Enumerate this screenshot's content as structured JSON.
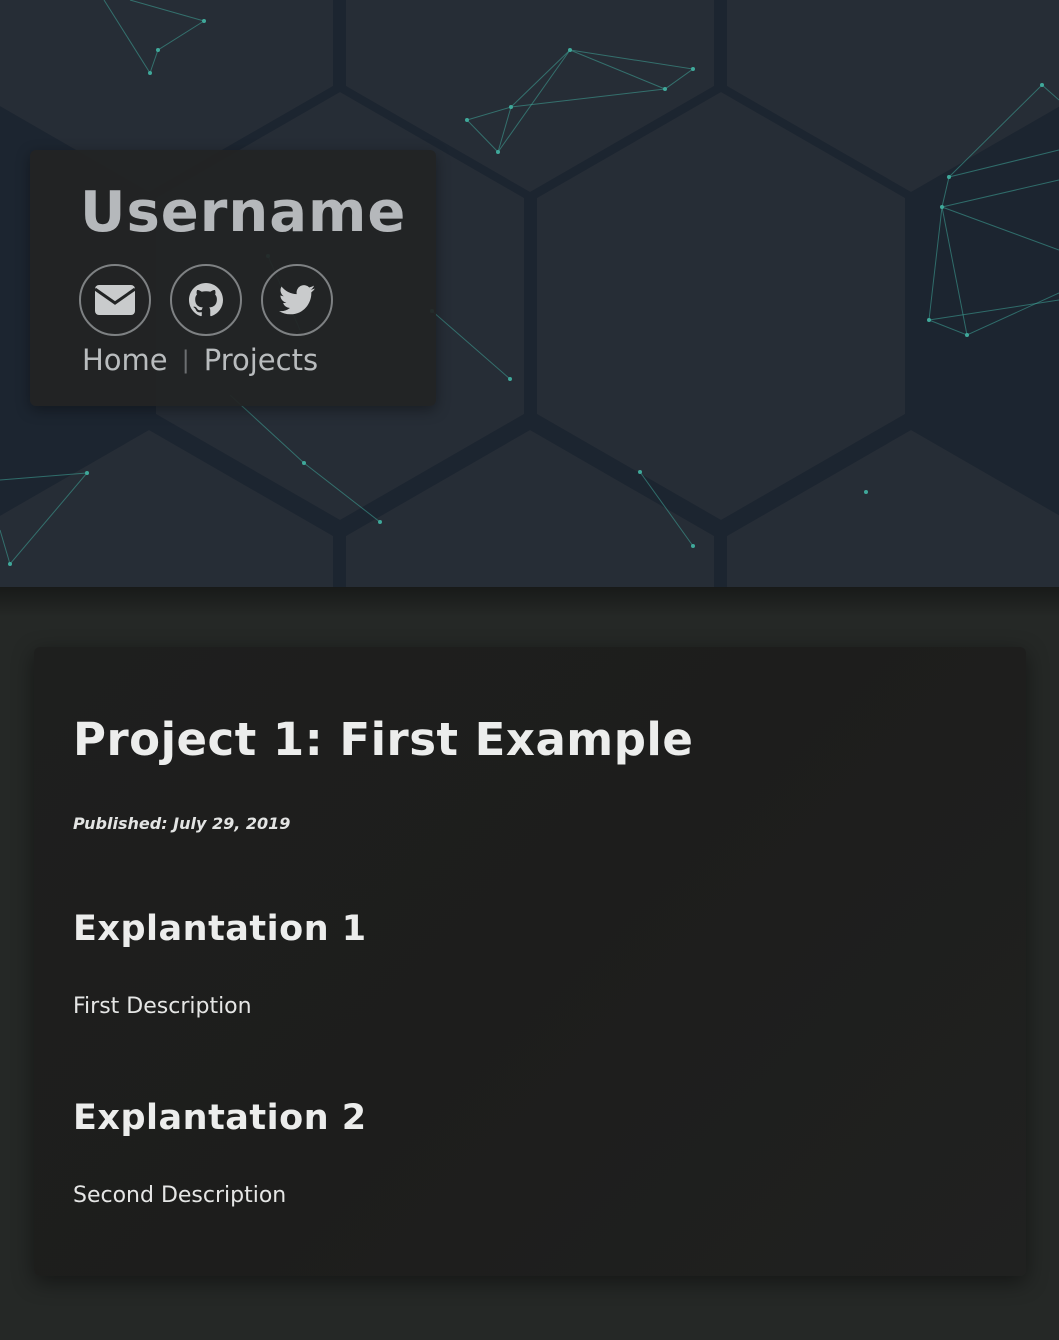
{
  "header": {
    "username": "Username",
    "social_links": [
      {
        "name": "email",
        "icon": "envelope-icon"
      },
      {
        "name": "github",
        "icon": "github-icon"
      },
      {
        "name": "twitter",
        "icon": "twitter-icon"
      }
    ],
    "nav": {
      "home_label": "Home",
      "separator": "|",
      "projects_label": "Projects"
    }
  },
  "article": {
    "title": "Project 1: First Example",
    "published": "Published: July 29, 2019",
    "sections": [
      {
        "heading": "Explantation 1",
        "text": "First Description"
      },
      {
        "heading": "Explantation 2",
        "text": "Second Description"
      }
    ]
  },
  "colors": {
    "hero_background": "#1c2530",
    "hexagon_fill": "#262d36",
    "network_accent": "#3fa89a",
    "card_background": "#1e1f1e",
    "page_background": "#252826"
  }
}
